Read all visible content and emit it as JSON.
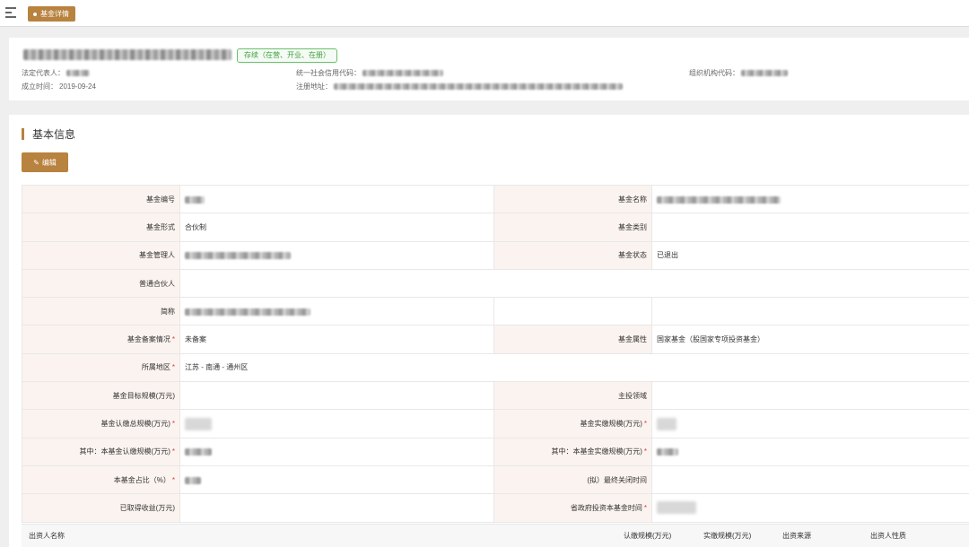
{
  "topbar": {
    "tab_label": "基金详情"
  },
  "header": {
    "status_badge": "存续（在营、开业、在册）",
    "legal_rep_label": "法定代表人：",
    "established_label": "成立时间：",
    "established_value": "2019-09-24",
    "credit_code_label": "统一社会信用代码：",
    "address_label": "注册地址：",
    "org_code_label": "组织机构代码："
  },
  "section": {
    "title": "基本信息",
    "edit_label": "编辑"
  },
  "rows": [
    [
      {
        "label": "基金编号",
        "value": "",
        "blur": 22
      },
      {
        "label": "基金名称",
        "value": "",
        "blur": 138
      }
    ],
    [
      {
        "label": "基金形式",
        "value": "合伙制"
      },
      {
        "label": "基金类别",
        "value": ""
      }
    ],
    [
      {
        "label": "基金管理人",
        "value": "",
        "blur": 118
      },
      {
        "label": "基金状态",
        "value": "已退出"
      }
    ],
    [
      {
        "label": "普通合伙人",
        "value": "",
        "full": true
      }
    ],
    [
      {
        "label": "简称",
        "value": "",
        "blur": 140
      },
      {
        "label": "",
        "value": ""
      }
    ],
    [
      {
        "label": "基金备案情况",
        "required": true,
        "value": "未备案"
      },
      {
        "label": "基金属性",
        "value": "国家基金（股国家专项投资基金）"
      }
    ],
    [
      {
        "label": "所属地区",
        "required": true,
        "value": "江苏 - 南通 - 通州区",
        "full": true
      }
    ],
    [
      {
        "label": "基金目标规模(万元)",
        "value": ""
      },
      {
        "label": "主投领域",
        "value": ""
      }
    ],
    [
      {
        "label": "基金认缴总规模(万元)",
        "required": true,
        "value": "",
        "block": 30
      },
      {
        "label": "基金实缴规模(万元)",
        "required": true,
        "value": "",
        "block": 22
      }
    ],
    [
      {
        "label": "其中：本基金认缴规模(万元)",
        "required": true,
        "value": "",
        "blur": 30
      },
      {
        "label": "其中：本基金实缴规模(万元)",
        "required": true,
        "value": "",
        "blur": 24
      }
    ],
    [
      {
        "label": "本基金占比（%）",
        "required": true,
        "value": "",
        "blur": 18
      },
      {
        "label": "(拟）最终关闭时间",
        "value": ""
      }
    ],
    [
      {
        "label": "已取得收益(万元)",
        "value": ""
      },
      {
        "label": "省政府投资本基金时间",
        "required": true,
        "value": "",
        "block": 44
      }
    ]
  ],
  "investor_table": {
    "columns": [
      "出资人名称",
      "认缴规模(万元)",
      "实缴规模(万元)",
      "出资来源",
      "出资人性质"
    ]
  }
}
